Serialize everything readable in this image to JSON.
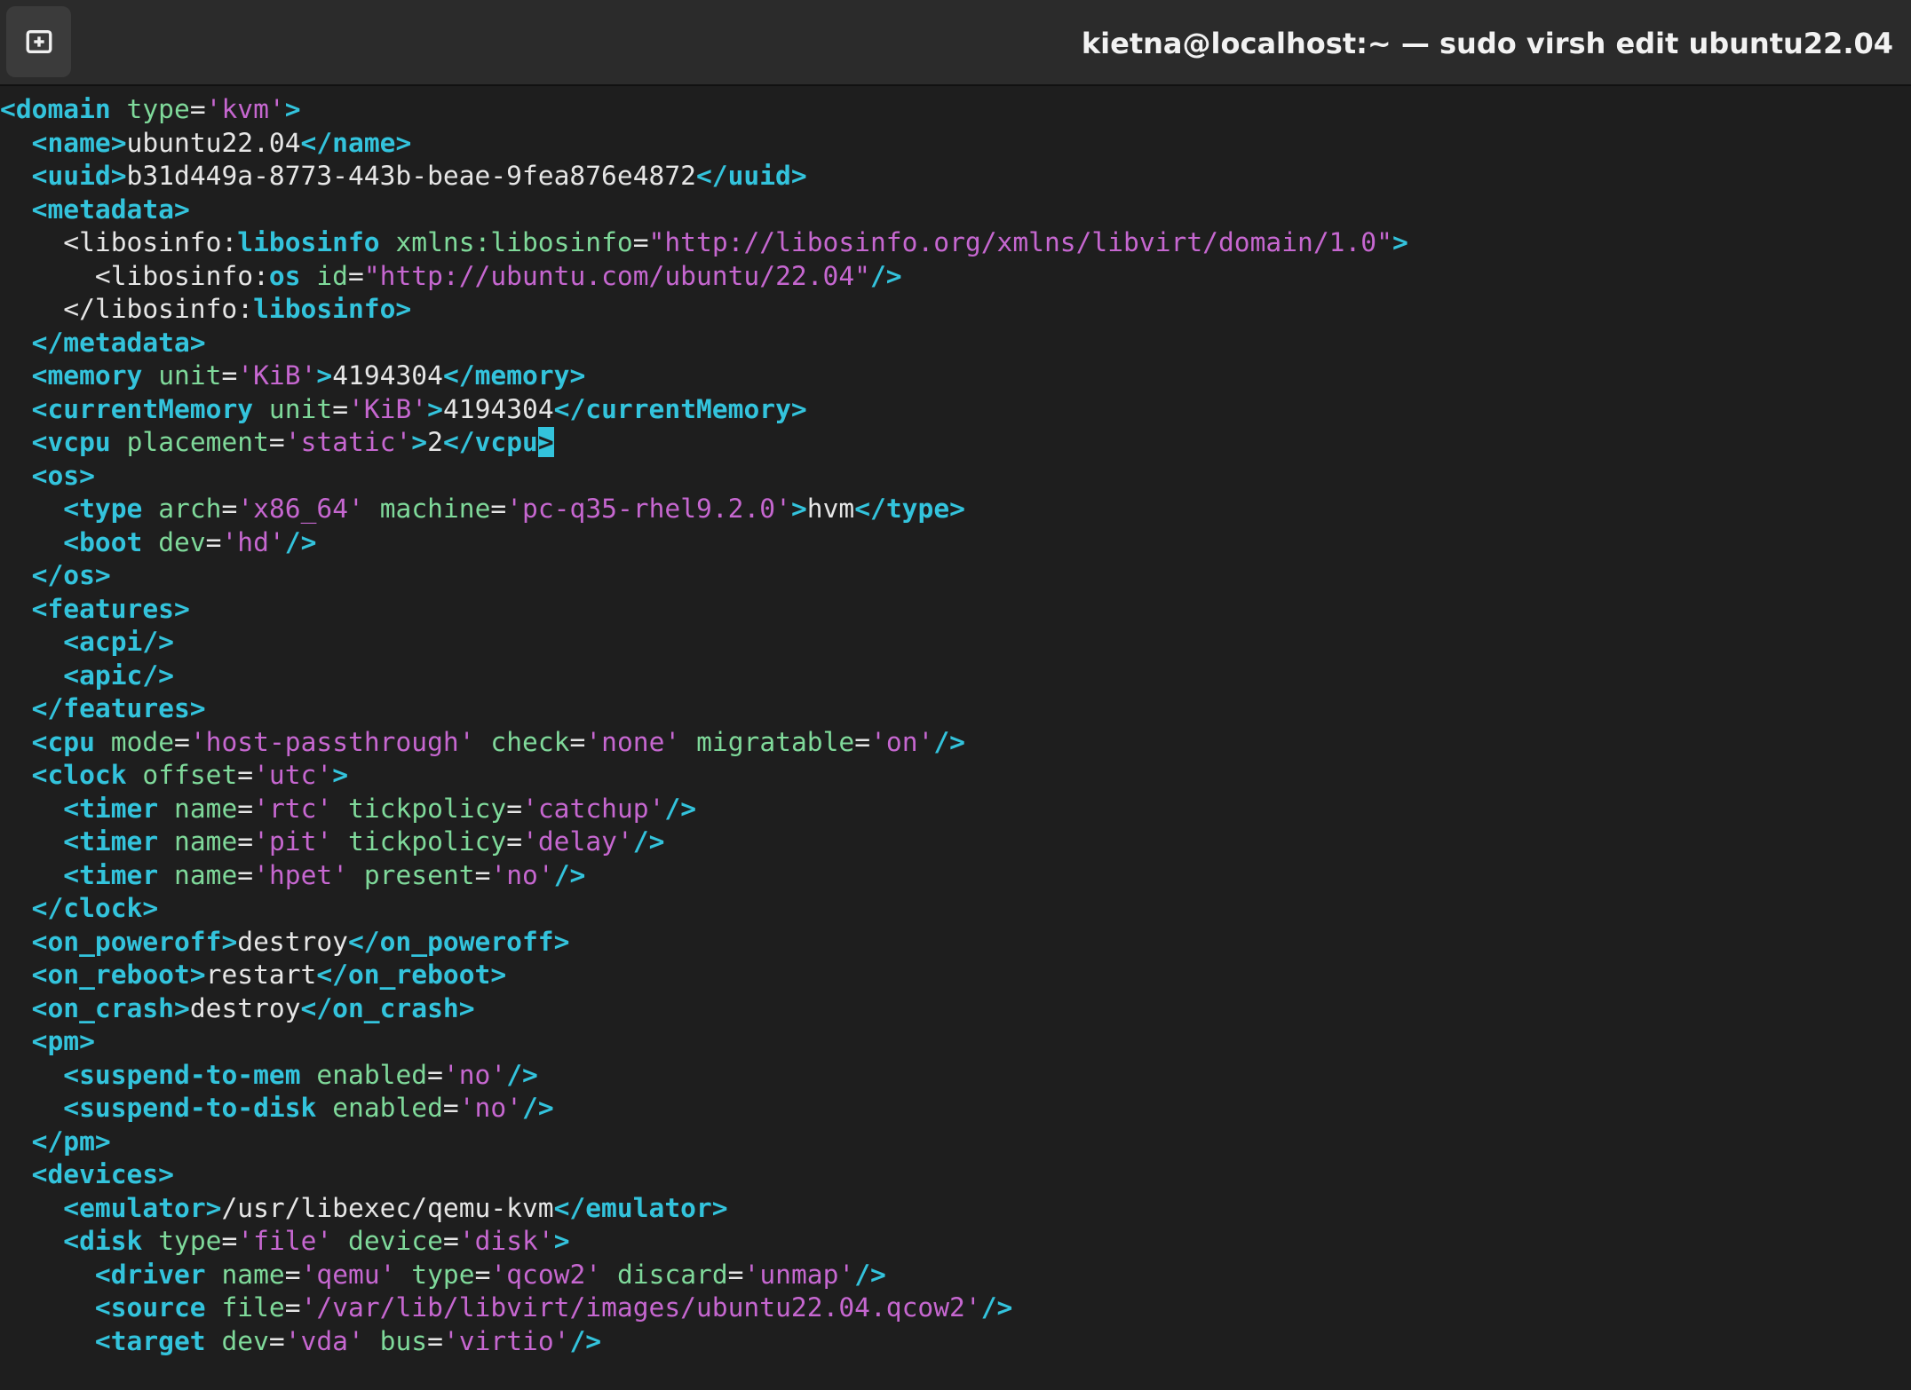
{
  "window": {
    "title": "kietna@localhost:~ — sudo virsh edit ubuntu22.04",
    "new_tab_icon": "new-tab-plus-icon"
  },
  "colors": {
    "background": "#1e1e1e",
    "titlebar": "#2b2b2b",
    "tag": "#33c3dc",
    "attribute": "#7fd99a",
    "value": "#c667d0",
    "text": "#e6e6e6"
  },
  "editor": {
    "cursor_line": 10,
    "lines": [
      [
        [
          "t",
          "<domain"
        ],
        [
          "x",
          " "
        ],
        [
          "a",
          "type"
        ],
        [
          "x",
          "="
        ],
        [
          "v",
          "'kvm'"
        ],
        [
          "t",
          ">"
        ]
      ],
      [
        [
          "x",
          "  "
        ],
        [
          "t",
          "<name>"
        ],
        [
          "x",
          "ubuntu22.04"
        ],
        [
          "t",
          "</name>"
        ]
      ],
      [
        [
          "x",
          "  "
        ],
        [
          "t",
          "<uuid>"
        ],
        [
          "x",
          "b31d449a-8773-443b-beae-9fea876e4872"
        ],
        [
          "t",
          "</uuid>"
        ]
      ],
      [
        [
          "x",
          "  "
        ],
        [
          "t",
          "<metadata>"
        ]
      ],
      [
        [
          "x",
          "    <libosinfo:"
        ],
        [
          "t",
          "libosinfo"
        ],
        [
          "x",
          " "
        ],
        [
          "a",
          "xmlns:libosinfo"
        ],
        [
          "x",
          "="
        ],
        [
          "v",
          "\"http://libosinfo.org/xmlns/libvirt/domain/1.0\""
        ],
        [
          "t",
          ">"
        ]
      ],
      [
        [
          "x",
          "      <libosinfo:"
        ],
        [
          "t",
          "os"
        ],
        [
          "x",
          " "
        ],
        [
          "a",
          "id"
        ],
        [
          "x",
          "="
        ],
        [
          "v",
          "\"http://ubuntu.com/ubuntu/22.04\""
        ],
        [
          "t",
          "/>"
        ]
      ],
      [
        [
          "x",
          "    </libosinfo:"
        ],
        [
          "t",
          "libosinfo>"
        ]
      ],
      [
        [
          "x",
          "  "
        ],
        [
          "t",
          "</metadata>"
        ]
      ],
      [
        [
          "x",
          "  "
        ],
        [
          "t",
          "<memory"
        ],
        [
          "x",
          " "
        ],
        [
          "a",
          "unit"
        ],
        [
          "x",
          "="
        ],
        [
          "v",
          "'KiB'"
        ],
        [
          "t",
          ">"
        ],
        [
          "x",
          "4194304"
        ],
        [
          "t",
          "</memory>"
        ]
      ],
      [
        [
          "x",
          "  "
        ],
        [
          "t",
          "<currentMemory"
        ],
        [
          "x",
          " "
        ],
        [
          "a",
          "unit"
        ],
        [
          "x",
          "="
        ],
        [
          "v",
          "'KiB'"
        ],
        [
          "t",
          ">"
        ],
        [
          "x",
          "4194304"
        ],
        [
          "t",
          "</currentMemory>"
        ]
      ],
      [
        [
          "x",
          "  "
        ],
        [
          "t",
          "<vcpu"
        ],
        [
          "x",
          " "
        ],
        [
          "a",
          "placement"
        ],
        [
          "x",
          "="
        ],
        [
          "v",
          "'static'"
        ],
        [
          "t",
          ">"
        ],
        [
          "x",
          "2"
        ],
        [
          "t",
          "</vcpu"
        ],
        [
          "cursor",
          ">"
        ]
      ],
      [
        [
          "x",
          "  "
        ],
        [
          "t",
          "<os>"
        ]
      ],
      [
        [
          "x",
          "    "
        ],
        [
          "t",
          "<type"
        ],
        [
          "x",
          " "
        ],
        [
          "a",
          "arch"
        ],
        [
          "x",
          "="
        ],
        [
          "v",
          "'x86_64'"
        ],
        [
          "x",
          " "
        ],
        [
          "a",
          "machine"
        ],
        [
          "x",
          "="
        ],
        [
          "v",
          "'pc-q35-rhel9.2.0'"
        ],
        [
          "t",
          ">"
        ],
        [
          "x",
          "hvm"
        ],
        [
          "t",
          "</type>"
        ]
      ],
      [
        [
          "x",
          "    "
        ],
        [
          "t",
          "<boot"
        ],
        [
          "x",
          " "
        ],
        [
          "a",
          "dev"
        ],
        [
          "x",
          "="
        ],
        [
          "v",
          "'hd'"
        ],
        [
          "t",
          "/>"
        ]
      ],
      [
        [
          "x",
          "  "
        ],
        [
          "t",
          "</os>"
        ]
      ],
      [
        [
          "x",
          "  "
        ],
        [
          "t",
          "<features>"
        ]
      ],
      [
        [
          "x",
          "    "
        ],
        [
          "t",
          "<acpi/>"
        ]
      ],
      [
        [
          "x",
          "    "
        ],
        [
          "t",
          "<apic/>"
        ]
      ],
      [
        [
          "x",
          "  "
        ],
        [
          "t",
          "</features>"
        ]
      ],
      [
        [
          "x",
          "  "
        ],
        [
          "t",
          "<cpu"
        ],
        [
          "x",
          " "
        ],
        [
          "a",
          "mode"
        ],
        [
          "x",
          "="
        ],
        [
          "v",
          "'host-passthrough'"
        ],
        [
          "x",
          " "
        ],
        [
          "a",
          "check"
        ],
        [
          "x",
          "="
        ],
        [
          "v",
          "'none'"
        ],
        [
          "x",
          " "
        ],
        [
          "a",
          "migratable"
        ],
        [
          "x",
          "="
        ],
        [
          "v",
          "'on'"
        ],
        [
          "t",
          "/>"
        ]
      ],
      [
        [
          "x",
          "  "
        ],
        [
          "t",
          "<clock"
        ],
        [
          "x",
          " "
        ],
        [
          "a",
          "offset"
        ],
        [
          "x",
          "="
        ],
        [
          "v",
          "'utc'"
        ],
        [
          "t",
          ">"
        ]
      ],
      [
        [
          "x",
          "    "
        ],
        [
          "t",
          "<timer"
        ],
        [
          "x",
          " "
        ],
        [
          "a",
          "name"
        ],
        [
          "x",
          "="
        ],
        [
          "v",
          "'rtc'"
        ],
        [
          "x",
          " "
        ],
        [
          "a",
          "tickpolicy"
        ],
        [
          "x",
          "="
        ],
        [
          "v",
          "'catchup'"
        ],
        [
          "t",
          "/>"
        ]
      ],
      [
        [
          "x",
          "    "
        ],
        [
          "t",
          "<timer"
        ],
        [
          "x",
          " "
        ],
        [
          "a",
          "name"
        ],
        [
          "x",
          "="
        ],
        [
          "v",
          "'pit'"
        ],
        [
          "x",
          " "
        ],
        [
          "a",
          "tickpolicy"
        ],
        [
          "x",
          "="
        ],
        [
          "v",
          "'delay'"
        ],
        [
          "t",
          "/>"
        ]
      ],
      [
        [
          "x",
          "    "
        ],
        [
          "t",
          "<timer"
        ],
        [
          "x",
          " "
        ],
        [
          "a",
          "name"
        ],
        [
          "x",
          "="
        ],
        [
          "v",
          "'hpet'"
        ],
        [
          "x",
          " "
        ],
        [
          "a",
          "present"
        ],
        [
          "x",
          "="
        ],
        [
          "v",
          "'no'"
        ],
        [
          "t",
          "/>"
        ]
      ],
      [
        [
          "x",
          "  "
        ],
        [
          "t",
          "</clock>"
        ]
      ],
      [
        [
          "x",
          "  "
        ],
        [
          "t",
          "<on_poweroff>"
        ],
        [
          "x",
          "destroy"
        ],
        [
          "t",
          "</on_poweroff>"
        ]
      ],
      [
        [
          "x",
          "  "
        ],
        [
          "t",
          "<on_reboot>"
        ],
        [
          "x",
          "restart"
        ],
        [
          "t",
          "</on_reboot>"
        ]
      ],
      [
        [
          "x",
          "  "
        ],
        [
          "t",
          "<on_crash>"
        ],
        [
          "x",
          "destroy"
        ],
        [
          "t",
          "</on_crash>"
        ]
      ],
      [
        [
          "x",
          "  "
        ],
        [
          "t",
          "<pm>"
        ]
      ],
      [
        [
          "x",
          "    "
        ],
        [
          "t",
          "<suspend-to-mem"
        ],
        [
          "x",
          " "
        ],
        [
          "a",
          "enabled"
        ],
        [
          "x",
          "="
        ],
        [
          "v",
          "'no'"
        ],
        [
          "t",
          "/>"
        ]
      ],
      [
        [
          "x",
          "    "
        ],
        [
          "t",
          "<suspend-to-disk"
        ],
        [
          "x",
          " "
        ],
        [
          "a",
          "enabled"
        ],
        [
          "x",
          "="
        ],
        [
          "v",
          "'no'"
        ],
        [
          "t",
          "/>"
        ]
      ],
      [
        [
          "x",
          "  "
        ],
        [
          "t",
          "</pm>"
        ]
      ],
      [
        [
          "x",
          "  "
        ],
        [
          "t",
          "<devices>"
        ]
      ],
      [
        [
          "x",
          "    "
        ],
        [
          "t",
          "<emulator>"
        ],
        [
          "x",
          "/usr/libexec/qemu-kvm"
        ],
        [
          "t",
          "</emulator>"
        ]
      ],
      [
        [
          "x",
          "    "
        ],
        [
          "t",
          "<disk"
        ],
        [
          "x",
          " "
        ],
        [
          "a",
          "type"
        ],
        [
          "x",
          "="
        ],
        [
          "v",
          "'file'"
        ],
        [
          "x",
          " "
        ],
        [
          "a",
          "device"
        ],
        [
          "x",
          "="
        ],
        [
          "v",
          "'disk'"
        ],
        [
          "t",
          ">"
        ]
      ],
      [
        [
          "x",
          "      "
        ],
        [
          "t",
          "<driver"
        ],
        [
          "x",
          " "
        ],
        [
          "a",
          "name"
        ],
        [
          "x",
          "="
        ],
        [
          "v",
          "'qemu'"
        ],
        [
          "x",
          " "
        ],
        [
          "a",
          "type"
        ],
        [
          "x",
          "="
        ],
        [
          "v",
          "'qcow2'"
        ],
        [
          "x",
          " "
        ],
        [
          "a",
          "discard"
        ],
        [
          "x",
          "="
        ],
        [
          "v",
          "'unmap'"
        ],
        [
          "t",
          "/>"
        ]
      ],
      [
        [
          "x",
          "      "
        ],
        [
          "t",
          "<source"
        ],
        [
          "x",
          " "
        ],
        [
          "a",
          "file"
        ],
        [
          "x",
          "="
        ],
        [
          "v",
          "'/var/lib/libvirt/images/ubuntu22.04.qcow2'"
        ],
        [
          "t",
          "/>"
        ]
      ],
      [
        [
          "x",
          "      "
        ],
        [
          "t",
          "<target"
        ],
        [
          "x",
          " "
        ],
        [
          "a",
          "dev"
        ],
        [
          "x",
          "="
        ],
        [
          "v",
          "'vda'"
        ],
        [
          "x",
          " "
        ],
        [
          "a",
          "bus"
        ],
        [
          "x",
          "="
        ],
        [
          "v",
          "'virtio'"
        ],
        [
          "t",
          "/>"
        ]
      ]
    ]
  }
}
